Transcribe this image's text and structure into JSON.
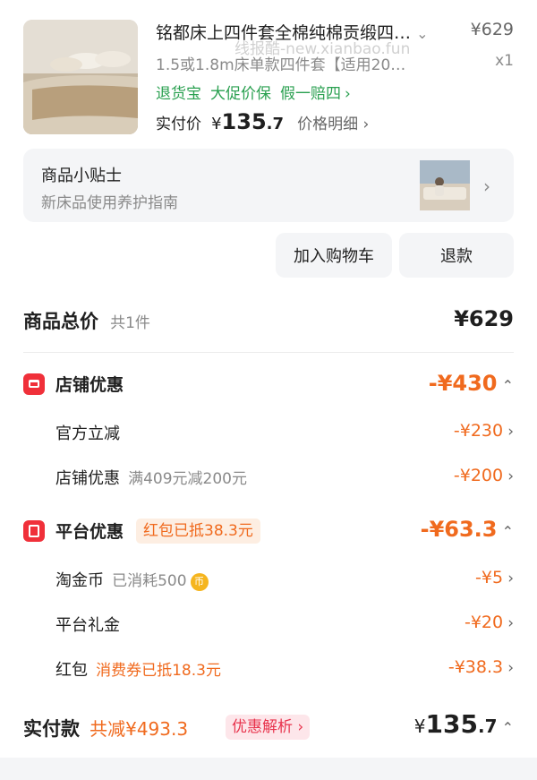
{
  "product": {
    "title": "铭都床上四件套全棉纯棉贡缎四…",
    "spec": "1.5或1.8m床单款四件套【适用20…",
    "price": "¥629",
    "quantity": "x1",
    "guarantees": [
      "退货宝",
      "大促价保",
      "假一赔四"
    ],
    "paid_label": "实付价",
    "paid_currency": "¥",
    "paid_int": "135",
    "paid_dec": ".7",
    "price_detail": "价格明细"
  },
  "watermark": "线报酷-new.xianbao.fun",
  "tip": {
    "title": "商品小贴士",
    "subtitle": "新床品使用养护指南"
  },
  "actions": {
    "add_to_cart": "加入购物车",
    "refund": "退款"
  },
  "total": {
    "label": "商品总价",
    "count": "共1件",
    "amount": "¥629"
  },
  "shop_discount": {
    "title": "店铺优惠",
    "amount": "-¥430",
    "items": [
      {
        "label": "官方立减",
        "note": "",
        "amount": "-¥230"
      },
      {
        "label": "店铺优惠",
        "note": "满409元减200元",
        "amount": "-¥200"
      }
    ]
  },
  "platform_discount": {
    "title": "平台优惠",
    "badge": "红包已抵38.3元",
    "amount": "-¥63.3",
    "items": [
      {
        "label": "淘金币",
        "note": "已消耗500",
        "coin": "币",
        "amount": "-¥5"
      },
      {
        "label": "平台礼金",
        "note": "",
        "amount": "-¥20"
      },
      {
        "label": "红包",
        "note": "消费券已抵18.3元",
        "amount": "-¥38.3"
      }
    ]
  },
  "footer": {
    "label": "实付款",
    "saved": "共减¥493.3",
    "analysis": "优惠解析",
    "currency": "¥",
    "int": "135",
    "dec": ".7"
  },
  "icons": {
    "chevron_right": "›",
    "chevron_down": "⌄",
    "chevron_up": "⌃"
  },
  "colors": {
    "accent_orange": "#f06a1e",
    "guarantee_green": "#2aa050",
    "badge_red": "#f0303a"
  }
}
